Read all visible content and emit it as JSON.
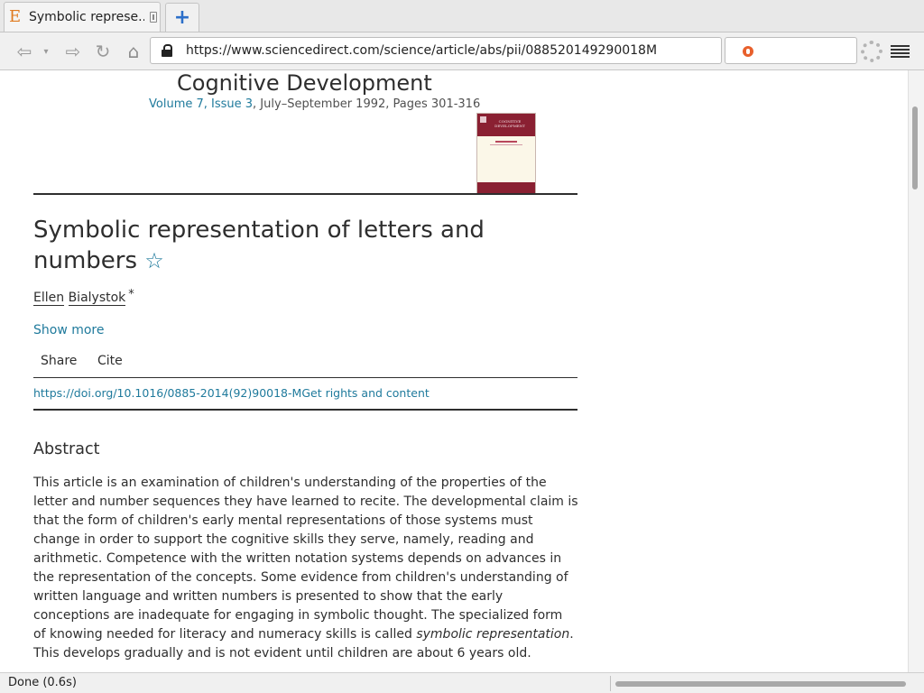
{
  "browser": {
    "tab": {
      "title": "Symbolic represe...",
      "favicon_glyph": "E"
    },
    "new_tab_glyph": "+",
    "nav": {
      "back_glyph": "⇦",
      "dropdown_glyph": "▾",
      "forward_glyph": "⇨",
      "reload_glyph": "↻",
      "home_glyph": "⌂"
    },
    "url": "https://www.sciencedirect.com/science/article/abs/pii/088520149290018M",
    "search_engine_icon": "duckduckgo-icon",
    "status": "Done (0.6s)"
  },
  "page": {
    "journal": "Cognitive Development",
    "issue": {
      "volume_link": "Volume 7, Issue 3",
      "details": ", July–September 1992, Pages 301-316"
    },
    "cover": {
      "label": "COGNITIVE DEVELOPMENT"
    },
    "article": {
      "title": "Symbolic representation of letters and numbers",
      "star_glyph": "☆",
      "author_first": "Ellen",
      "author_last": "Bialystok",
      "author_marker": "*",
      "show_more": "Show more",
      "share": "Share",
      "cite": "Cite",
      "doi": "https://doi.org/10.1016/0885-2014(92)90018-M",
      "rights": "Get rights and content"
    },
    "abstract": {
      "heading": "Abstract",
      "text_before": "This article is an examination of children's understanding of the properties of the letter and number sequences they have learned to recite. The developmental claim is that the form of children's early mental representations of those systems must change in order to support the cognitive skills they serve, namely, reading and arithmetic. Competence with the written notation systems depends on advances in the representation of the concepts. Some evidence from children's understanding of written language and written numbers is presented to show that the early conceptions are inadequate for engaging in symbolic thought. The specialized form of knowing needed for literacy and numeracy skills is called ",
      "term": "symbolic representation",
      "text_after": ". This develops gradually and is not evident until children are about 6 years old."
    }
  }
}
